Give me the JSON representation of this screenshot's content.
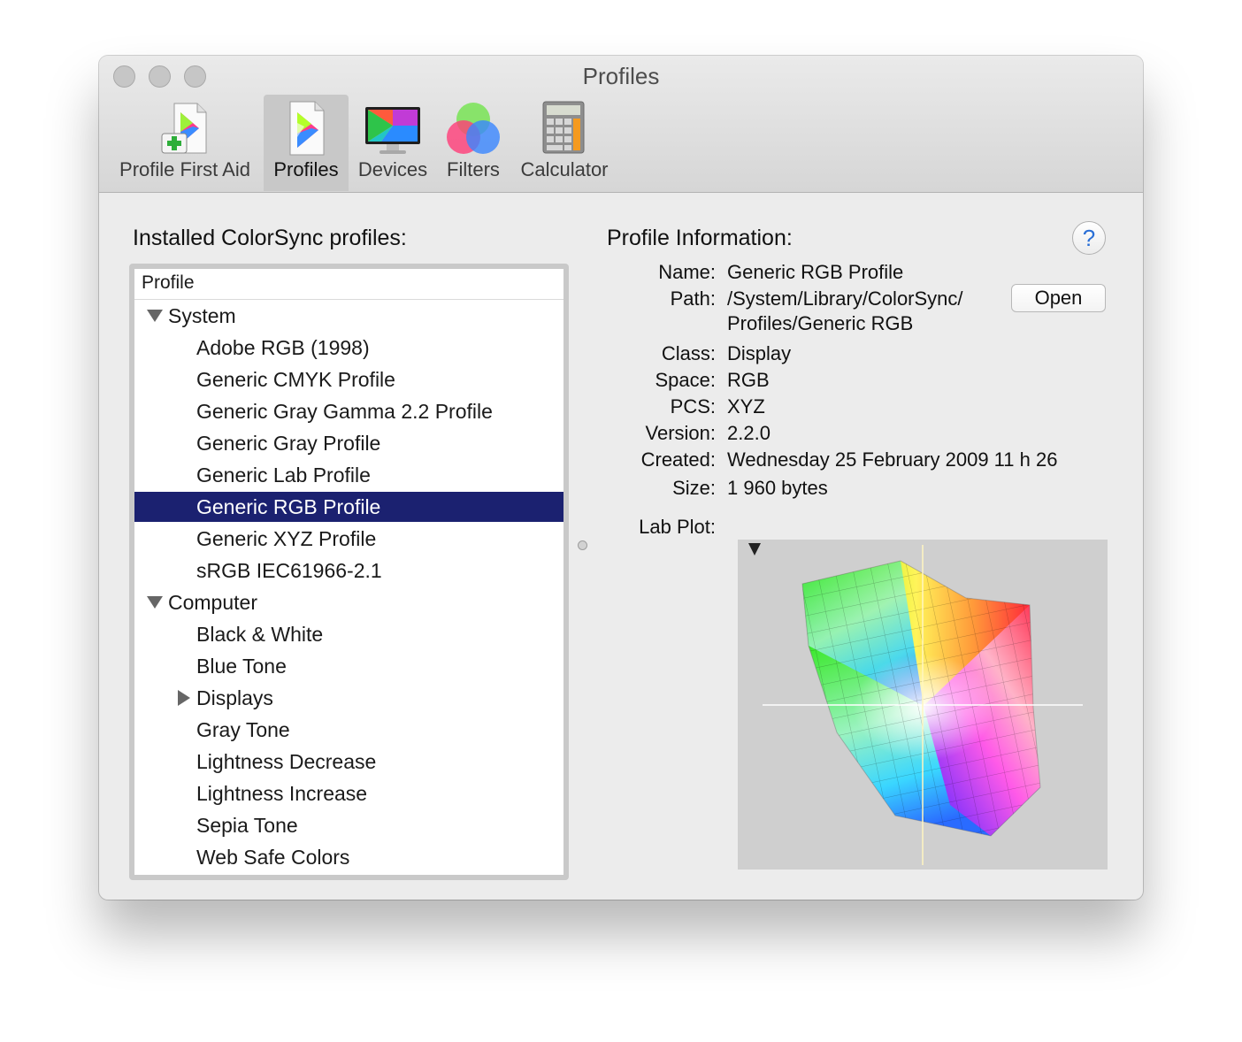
{
  "window": {
    "title": "Profiles"
  },
  "toolbar": {
    "items": [
      {
        "label": "Profile First Aid",
        "icon": "profile-first-aid-icon",
        "selected": false
      },
      {
        "label": "Profiles",
        "icon": "profiles-icon",
        "selected": true
      },
      {
        "label": "Devices",
        "icon": "devices-icon",
        "selected": false
      },
      {
        "label": "Filters",
        "icon": "filters-icon",
        "selected": false
      },
      {
        "label": "Calculator",
        "icon": "calculator-icon",
        "selected": false
      }
    ]
  },
  "profiles_panel": {
    "title": "Installed ColorSync profiles:",
    "column_header": "Profile",
    "groups": [
      {
        "name": "System",
        "expanded": true,
        "items": [
          "Adobe RGB (1998)",
          "Generic CMYK Profile",
          "Generic Gray Gamma 2.2 Profile",
          "Generic Gray Profile",
          "Generic Lab Profile",
          "Generic RGB Profile",
          "Generic XYZ Profile",
          "sRGB IEC61966-2.1"
        ]
      },
      {
        "name": "Computer",
        "expanded": true,
        "items": [
          "Black & White",
          "Blue Tone",
          "Displays",
          "Gray Tone",
          "Lightness Decrease",
          "Lightness Increase",
          "Sepia Tone",
          "Web Safe Colors"
        ]
      }
    ],
    "collapsed_subgroup": "Displays",
    "selected_item": "Generic RGB Profile"
  },
  "info_panel": {
    "title": "Profile Information:",
    "help_label": "?",
    "name_label": "Name:",
    "name_value": "Generic RGB Profile",
    "path_label": "Path:",
    "path_line1": "/System/Library/ColorSync/",
    "path_line2": "Profiles/Generic RGB",
    "open_button": "Open",
    "class_label": "Class:",
    "class_value": "Display",
    "space_label": "Space:",
    "space_value": "RGB",
    "pcs_label": "PCS:",
    "pcs_value": "XYZ",
    "version_label": "Version:",
    "version_value": "2.2.0",
    "created_label": "Created:",
    "created_value": "Wednesday 25 February 2009 11 h 26",
    "size_label": "Size:",
    "size_value": "1 960 bytes",
    "labplot_label": "Lab Plot:"
  },
  "colors": {
    "selection": "#1b2170",
    "window_bg": "#ececec",
    "help_accent": "#2a6fd6"
  }
}
